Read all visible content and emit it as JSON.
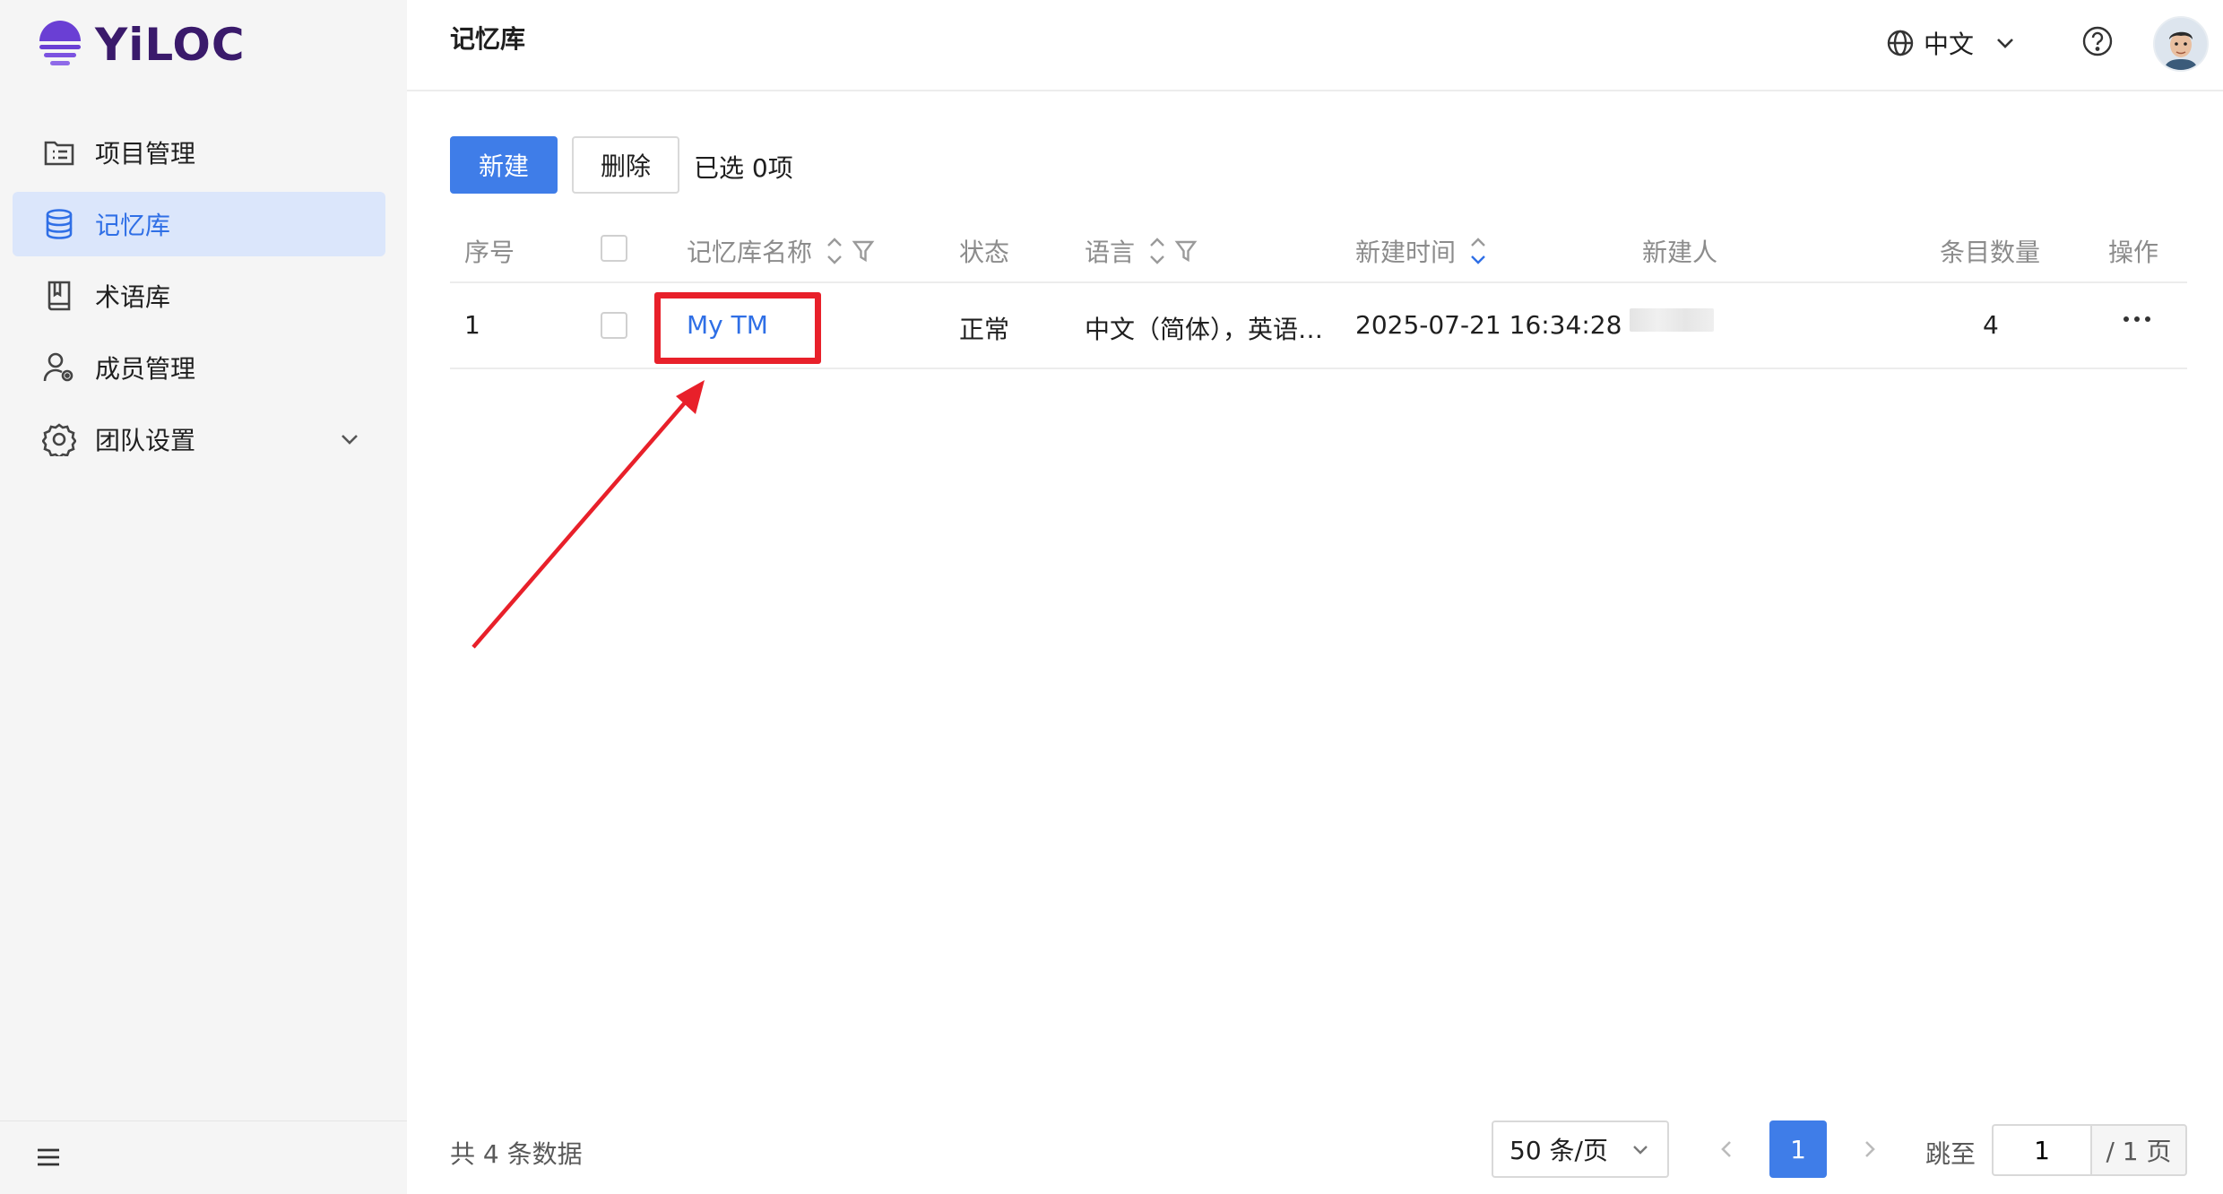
{
  "app": {
    "logo_text": "YiLOC",
    "brand_color": "#6a3fd4"
  },
  "sidebar": {
    "items": [
      {
        "label": "项目管理",
        "icon": "project-list-icon",
        "active": false
      },
      {
        "label": "记忆库",
        "icon": "database-icon",
        "active": true
      },
      {
        "label": "术语库",
        "icon": "book-icon",
        "active": false
      },
      {
        "label": "成员管理",
        "icon": "user-settings-icon",
        "active": false
      },
      {
        "label": "团队设置",
        "icon": "gear-icon",
        "active": false,
        "expandable": true
      }
    ],
    "menu_toggle_icon": "hamburger-icon"
  },
  "header": {
    "title": "记忆库",
    "language": "中文",
    "icons": [
      "globe-icon",
      "chevron-down-icon",
      "help-icon",
      "avatar"
    ]
  },
  "toolbar": {
    "new_label": "新建",
    "delete_label": "删除",
    "selected_text": "已选 0项"
  },
  "table": {
    "columns": {
      "index": "序号",
      "name": "记忆库名称",
      "status": "状态",
      "language": "语言",
      "created_time": "新建时间",
      "creator": "新建人",
      "count": "条目数量",
      "actions": "操作"
    },
    "rows": [
      {
        "index": "1",
        "name": "My TM",
        "status": "正常",
        "language": "中文（简体），英语…",
        "created_time": "2025-07-21 16:34:28",
        "creator": "",
        "count": "4"
      }
    ]
  },
  "footer": {
    "total_text": "共 4 条数据",
    "page_size": "50 条/页",
    "current_page": "1",
    "jump_label": "跳至",
    "jump_value": "1",
    "total_pages_text": "/ 1 页"
  },
  "colors": {
    "accent": "#3f7de8",
    "highlight": "#e8202a",
    "active_nav_bg": "#dbe6fb"
  }
}
